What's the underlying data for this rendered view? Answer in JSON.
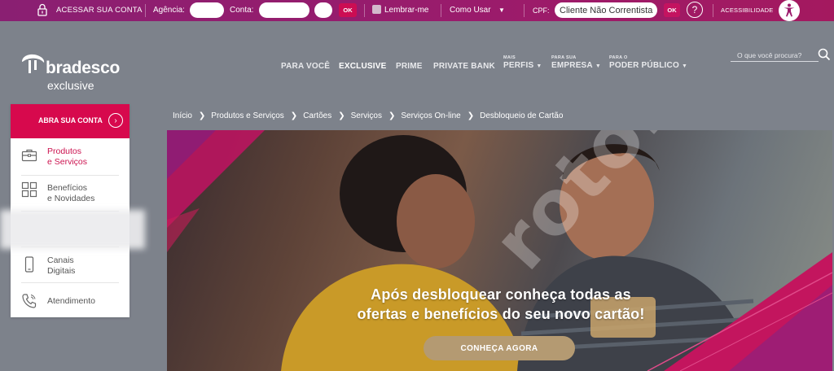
{
  "topbar": {
    "acessar_label": "ACESSAR SUA CONTA",
    "agencia_label": "Agência:",
    "conta_label": "Conta:",
    "ok_label": "OK",
    "lembrar_label": "Lembrar-me",
    "como_usar_label": "Como Usar",
    "cpf_label": "CPF:",
    "cpf_placeholder": "Cliente Não Correntista",
    "cpf_ok_label": "OK",
    "help_symbol": "?",
    "acessibilidade_label": "ACESSIBILIDADE"
  },
  "brand": {
    "name": "bradesco",
    "segment": "exclusive"
  },
  "nav": {
    "items": [
      {
        "label": "PARA VOCÊ"
      },
      {
        "label": "EXCLUSIVE"
      },
      {
        "label": "PRIME"
      },
      {
        "label": "PRIVATE BANK"
      },
      {
        "small": "MAIS",
        "label": "PERFIS"
      },
      {
        "small": "PARA SUA",
        "label": "EMPRESA"
      },
      {
        "small": "PARA O",
        "label": "PODER PÚBLICO"
      }
    ]
  },
  "search": {
    "placeholder": "O que você procura?"
  },
  "side": {
    "header_label": "ABRA SUA CONTA",
    "items": [
      {
        "label": "Produtos\ne Serviços"
      },
      {
        "label": "Benefícios\ne Novidades"
      },
      {
        "label": "Canais\nDigitais"
      },
      {
        "label": "Atendimento"
      }
    ]
  },
  "breadcrumb": {
    "items": [
      "Início",
      "Produtos e Serviços",
      "Cartões",
      "Serviços",
      "Serviços On-line",
      "Desbloqueio de Cartão"
    ],
    "separator": "❯"
  },
  "hero": {
    "headline_line1": "Após desbloquear conheça todas as",
    "headline_line2": "ofertas e benefícios do seu novo cartão!",
    "cta_label": "CONHEÇA AGORA",
    "watermark": "rotor"
  },
  "colors": {
    "topbar": "#9b1b6b",
    "brand_red": "#d7094d",
    "cta": "#b49a72",
    "header_bg": "#7d828b"
  }
}
